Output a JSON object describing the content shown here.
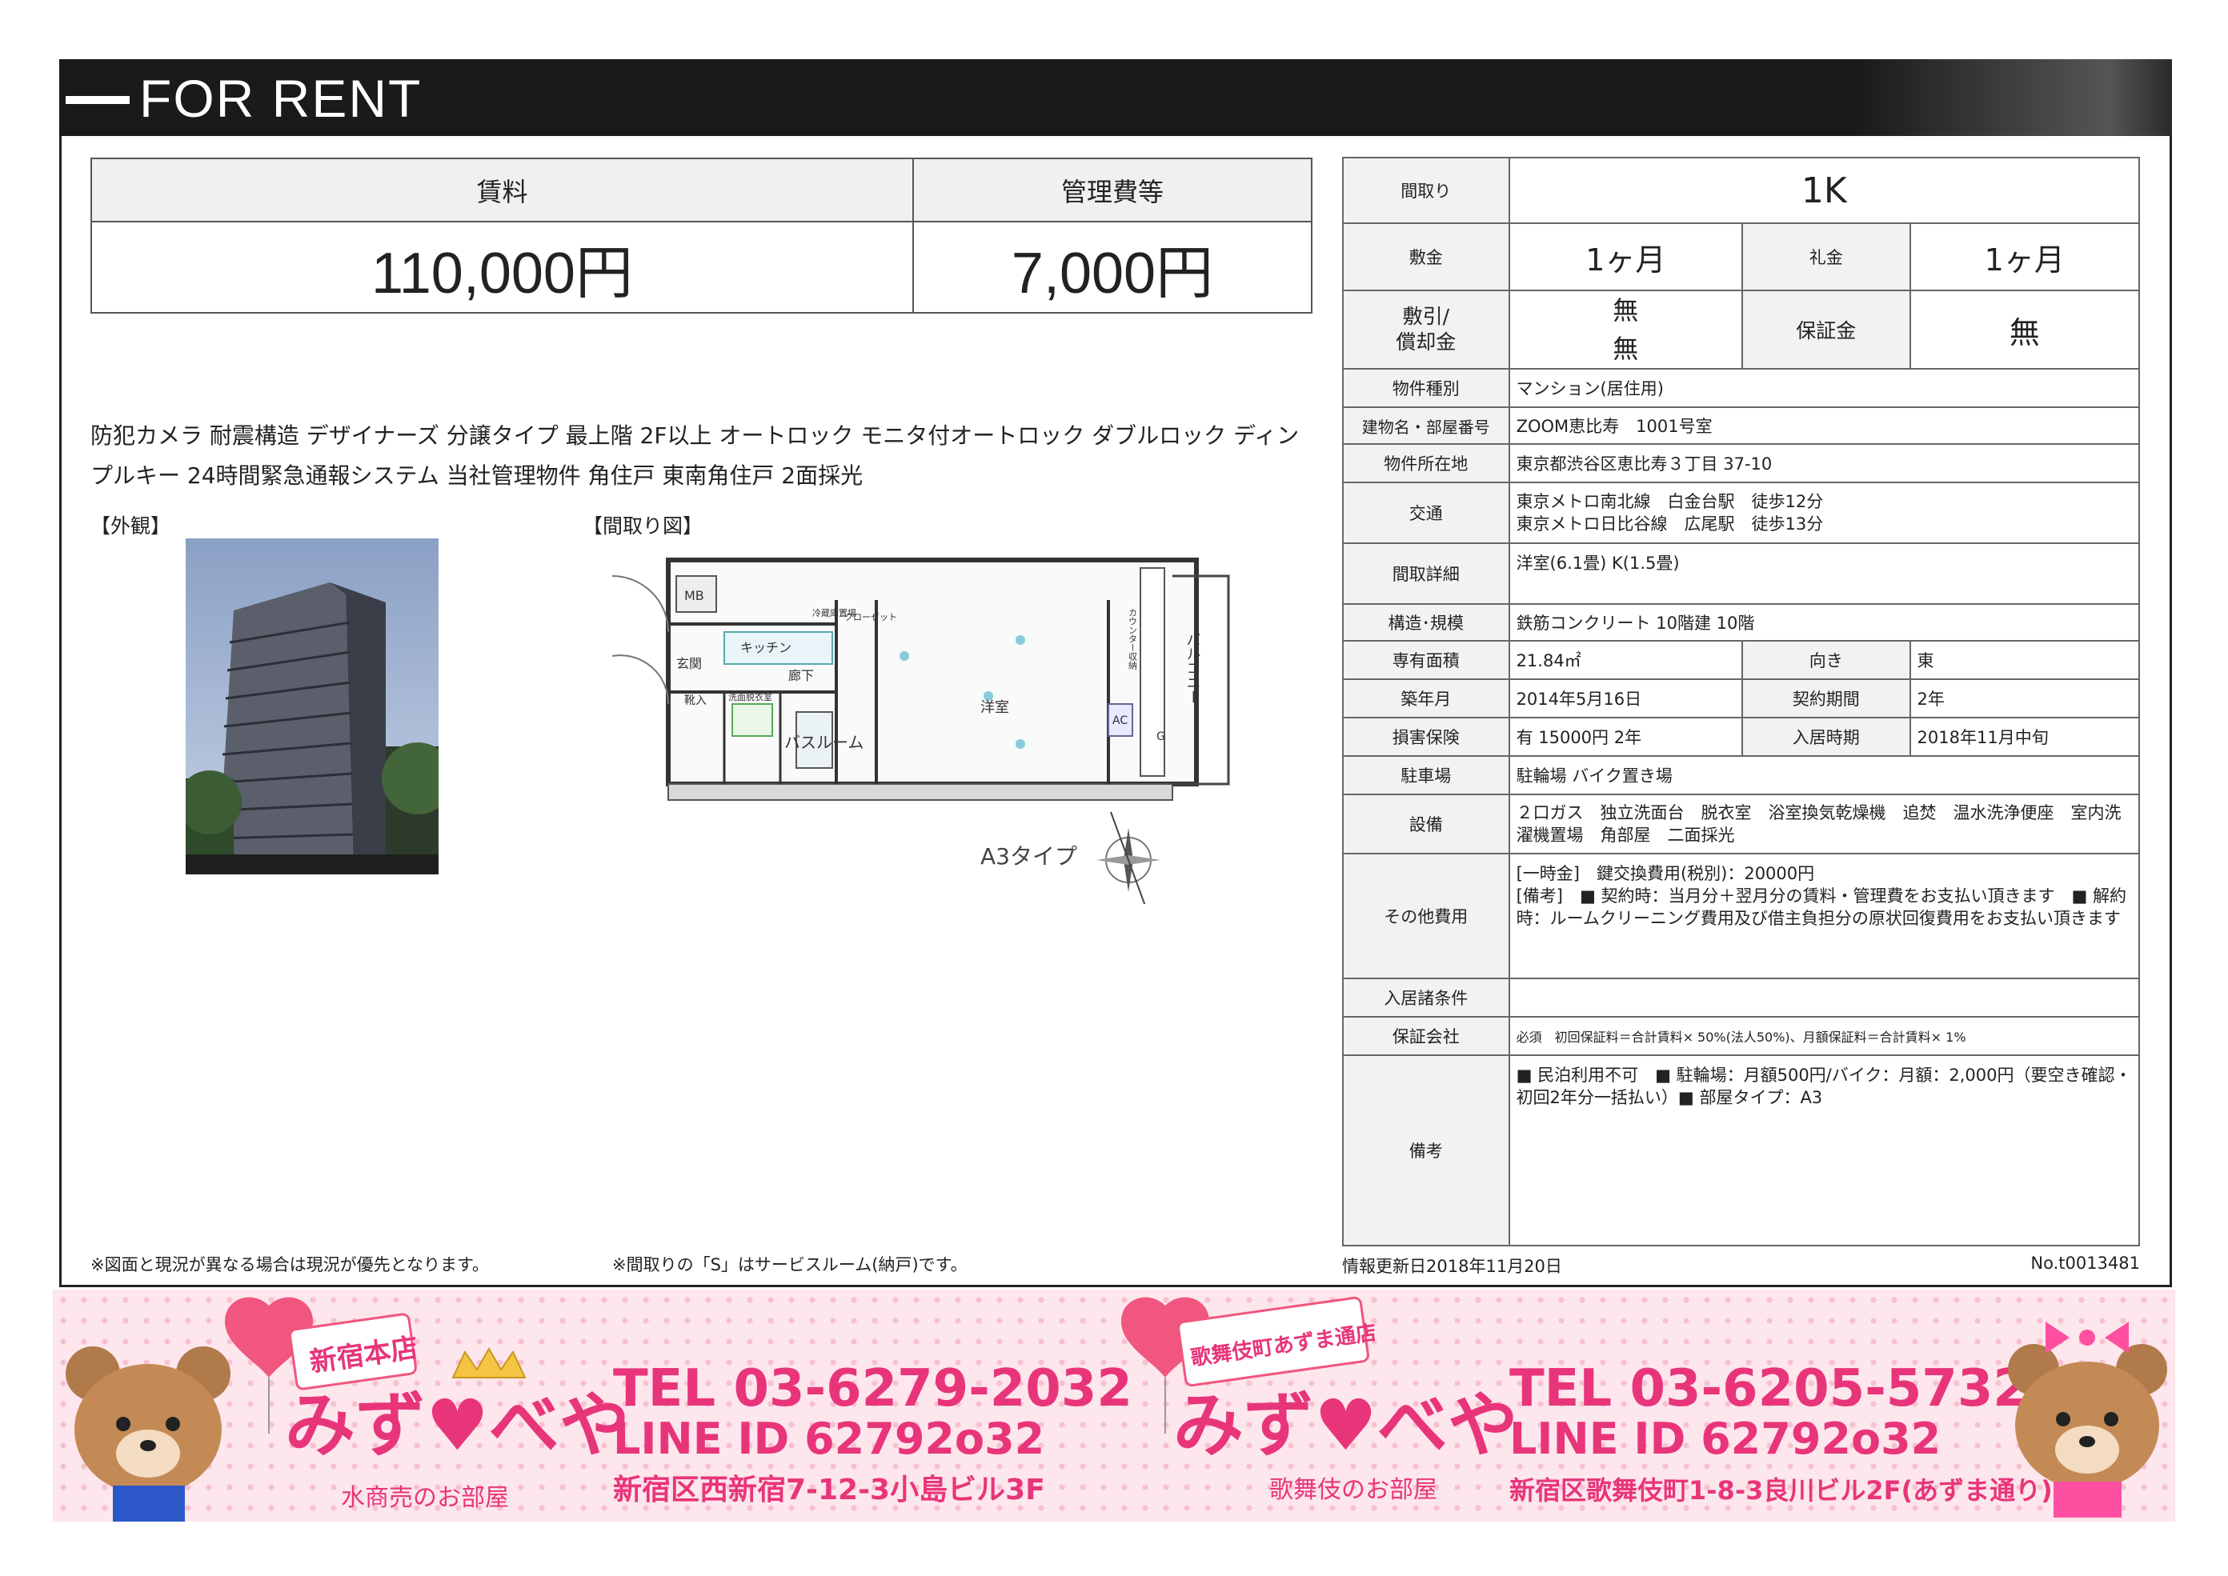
{
  "header": {
    "title": "FOR RENT"
  },
  "rent": {
    "rent_label": "賃料",
    "rent_value": "110,000円",
    "fee_label": "管理費等",
    "fee_value": "7,000円"
  },
  "features": "防犯カメラ 耐震構造 デザイナーズ 分譲タイプ 最上階 2F以上 オートロック モニタ付オートロック ダブルロック ディンプルキー 24時間緊急通報システム 当社管理物件 角住戸 東南角住戸 2面採光",
  "photo_label": "【外観】",
  "plan_label": "【間取り図】",
  "floor_plan": {
    "type_label": "A3タイプ",
    "rooms": {
      "mb": "MB",
      "refrigerator": "冷蔵庫置場",
      "closet": "クローゼット",
      "kitchen": "キッチン",
      "entrance": "玄関",
      "hallway": "廊下",
      "shoebox": "靴入",
      "washroom": "洗面脱衣室",
      "bath": "バスルーム",
      "western_room": "洋室",
      "balcony": "バルコニー",
      "cabinet": "カウンター収納",
      "ac": "AC",
      "g": "G"
    }
  },
  "notes": {
    "note1": "※図面と現況が異なる場合は現況が優先となります。",
    "note2": "※間取りの「S」はサービスルーム(納戸)です。"
  },
  "spec": {
    "layout": {
      "label": "間取り",
      "value": "1K"
    },
    "deposit": {
      "label": "敷金",
      "value": "1ヶ月"
    },
    "key_money": {
      "label": "礼金",
      "value": "1ヶ月"
    },
    "amortization": {
      "label": "敷引/\n償却金",
      "value1": "無",
      "value2": "無"
    },
    "guarantee": {
      "label": "保証金",
      "value": "無"
    },
    "type": {
      "label": "物件種別",
      "value": "マンション(居住用)"
    },
    "building": {
      "label": "建物名・部屋番号",
      "value": "ZOOM恵比寿　1001号室"
    },
    "address": {
      "label": "物件所在地",
      "value": "東京都渋谷区恵比寿３丁目 37-10"
    },
    "transport": {
      "label": "交通",
      "line1": "東京メトロ南北線　白金台駅　徒歩12分",
      "line2": "東京メトロ日比谷線　広尾駅　徒歩13分"
    },
    "detail": {
      "label": "間取詳細",
      "value": "洋室(6.1畳) K(1.5畳)"
    },
    "structure": {
      "label": "構造･規模",
      "value": "鉄筋コンクリート 10階建 10階"
    },
    "area": {
      "label": "専有面積",
      "value": "21.84㎡"
    },
    "direction": {
      "label": "向き",
      "value": "東"
    },
    "built": {
      "label": "築年月",
      "value": "2014年5月16日"
    },
    "contract": {
      "label": "契約期間",
      "value": "2年"
    },
    "insurance": {
      "label": "損害保険",
      "value": "有  15000円 2年"
    },
    "move_in": {
      "label": "入居時期",
      "value": "2018年11月中旬"
    },
    "parking": {
      "label": "駐車場",
      "value": "駐輪場 バイク置き場"
    },
    "equipment": {
      "label": "設備",
      "value": "２口ガス　独立洗面台　脱衣室　浴室換気乾燥機　追焚　温水洗浄便座　室内洗濯機置場　角部屋　二面採光"
    },
    "other_fees": {
      "label": "その他費用",
      "line1": "[一時金]　鍵交換費用(税別)：20000円",
      "line2": "[備考]　■ 契約時：当月分＋翌月分の賃料・管理費をお支払い頂きます　■ 解約時：ルームクリーニング費用及び借主負担分の原状回復費用をお支払い頂きます"
    },
    "conditions": {
      "label": "入居諸条件",
      "value": ""
    },
    "guarantor": {
      "label": "保証会社",
      "value": "必須　初回保証料＝合計賃料× 50%(法人50%)、月額保証料＝合計賃料× 1%"
    },
    "remarks": {
      "label": "備考",
      "value": "■ 民泊利用不可　■ 駐輪場：月額500円/バイク：月額：2,000円（要空き確認・初回2年分一括払い）■ 部屋タイプ：A3"
    }
  },
  "footer": {
    "updated": "情報更新日2018年11月20日",
    "ref": "No.t0013481"
  },
  "banner": {
    "left": {
      "store_tag": "新宿本店",
      "brand": "みず♥べや",
      "sub": "水商売のお部屋",
      "tel": "TEL 03-6279-2032",
      "line": "LINE ID 62792o32",
      "address": "新宿区西新宿7-12-3小島ビル3F"
    },
    "right": {
      "store_tag": "歌舞伎町あずま通店",
      "brand": "みず♥べや",
      "sub": "歌舞伎のお部屋",
      "tel": "TEL 03-6205-5732",
      "line": "LINE ID 62792o32",
      "address": "新宿区歌舞伎町1-8-3良川ビル2F(あずま通り)"
    },
    "colors": {
      "bg": "#fde6ec",
      "pink": "#e8357a",
      "heart": "#f0567f",
      "bear": "#b07a4a",
      "ribbon": "#ff4fa0"
    }
  }
}
